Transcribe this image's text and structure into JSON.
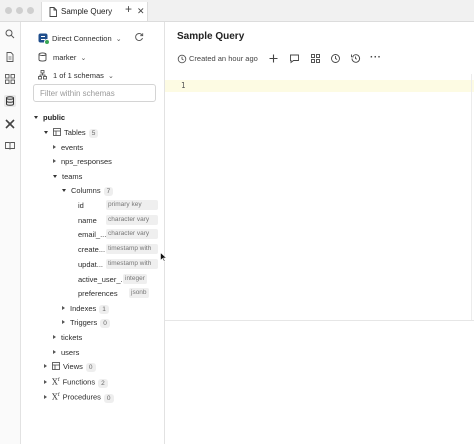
{
  "window": {
    "tab_title": "Sample Query",
    "icons": {
      "tab": "document-icon",
      "close": "close-icon",
      "new_tab": "plus-icon"
    }
  },
  "activity_bar": {
    "items": [
      "search-icon",
      "document-icon",
      "grid-icon",
      "database-icon",
      "plugin-icon",
      "book-icon"
    ],
    "active": "database-icon"
  },
  "sidebar": {
    "connection": "Direct Connection",
    "database": "marker",
    "schemas_selector": "1 of 1 schemas",
    "filter_placeholder": "Filter within schemas",
    "schema": "public",
    "tables_label": "Tables",
    "tables_count": "5",
    "tables": [
      "events",
      "nps_responses",
      "teams",
      "tickets",
      "users"
    ],
    "columns_label": "Columns",
    "columns_count": "7",
    "columns": [
      {
        "name": "id",
        "type": "primary key"
      },
      {
        "name": "name",
        "type": "character vary"
      },
      {
        "name": "email_...",
        "type": "character vary"
      },
      {
        "name": "create...",
        "type": "timestamp with"
      },
      {
        "name": "updat...",
        "type": "timestamp with"
      },
      {
        "name": "active_user_...",
        "type": "integer"
      },
      {
        "name": "preferences",
        "type": "jsonb"
      }
    ],
    "indexes_label": "Indexes",
    "indexes_count": "1",
    "triggers_label": "Triggers",
    "triggers_count": "0",
    "views_label": "Views",
    "views_count": "0",
    "functions_label": "Functions",
    "functions_count": "2",
    "procedures_label": "Procedures",
    "procedures_count": "0"
  },
  "main": {
    "title": "Sample Query",
    "created": "Created an hour ago",
    "line_number": "1",
    "toolbar_icons": [
      "plus-icon",
      "comment-icon",
      "grid-icon",
      "clock-icon",
      "history-icon",
      "more-icon"
    ]
  },
  "colors": {
    "active_line": "#fdfbe3",
    "connection_status": "#3aa655",
    "accent": "#1f4e8c"
  }
}
